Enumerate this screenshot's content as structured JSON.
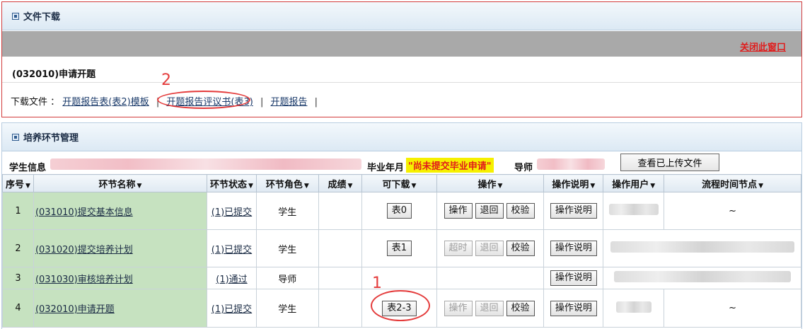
{
  "download_panel": {
    "title": "文件下载",
    "close_label": "关闭此窗口",
    "section_title": "(032010)申请开题",
    "files_prefix": "下载文件 ：",
    "files": [
      "开题报告表(表2)模板",
      "开题报告评议书(表3)",
      "开题报告"
    ],
    "separator": "|"
  },
  "annotations": {
    "mark1": "1",
    "mark2": "2"
  },
  "train_panel": {
    "title": "培养环节管理",
    "student_info_label": "学生信息",
    "graduation_label": "毕业年月",
    "graduation_value": "\"尚未提交毕业申请\"",
    "advisor_label": "导师",
    "view_uploaded_button": "查看已上传文件"
  },
  "table": {
    "headers": [
      "序号",
      "环节名称",
      "环节状态",
      "环节角色",
      "成绩",
      "可下载",
      "操作",
      "操作说明",
      "操作用户",
      "流程时间节点"
    ],
    "rows": [
      {
        "no": "1",
        "name": "(031010)提交基本信息",
        "status": "(1)已提交",
        "role": "学生",
        "download": "表0",
        "ops": [
          {
            "label": "操作",
            "disabled": false
          },
          {
            "label": "退回",
            "disabled": false
          },
          {
            "label": "校验",
            "disabled": false
          }
        ],
        "help": "操作说明",
        "time": "~"
      },
      {
        "no": "2",
        "name": "(031020)提交培养计划",
        "status": "(1)已提交",
        "role": "学生",
        "download": "表1",
        "ops": [
          {
            "label": "超时",
            "disabled": true
          },
          {
            "label": "退回",
            "disabled": true
          },
          {
            "label": "校验",
            "disabled": false
          }
        ],
        "help": "操作说明",
        "time": ""
      },
      {
        "no": "3",
        "name": "(031030)审核培养计划",
        "status": "(1)通过",
        "role": "导师",
        "download": "",
        "ops": [],
        "help": "操作说明",
        "time": ""
      },
      {
        "no": "4",
        "name": "(032010)申请开题",
        "status": "(1)已提交",
        "role": "学生",
        "download": "表2-3",
        "ops": [
          {
            "label": "操作",
            "disabled": true
          },
          {
            "label": "退回",
            "disabled": true
          },
          {
            "label": "校验",
            "disabled": false
          }
        ],
        "help": "操作说明",
        "time": "~"
      }
    ]
  },
  "colors": {
    "accent_red": "#e43b3b",
    "green_cell": "#c6e2c0",
    "highlight_yellow": "#f6f000"
  }
}
